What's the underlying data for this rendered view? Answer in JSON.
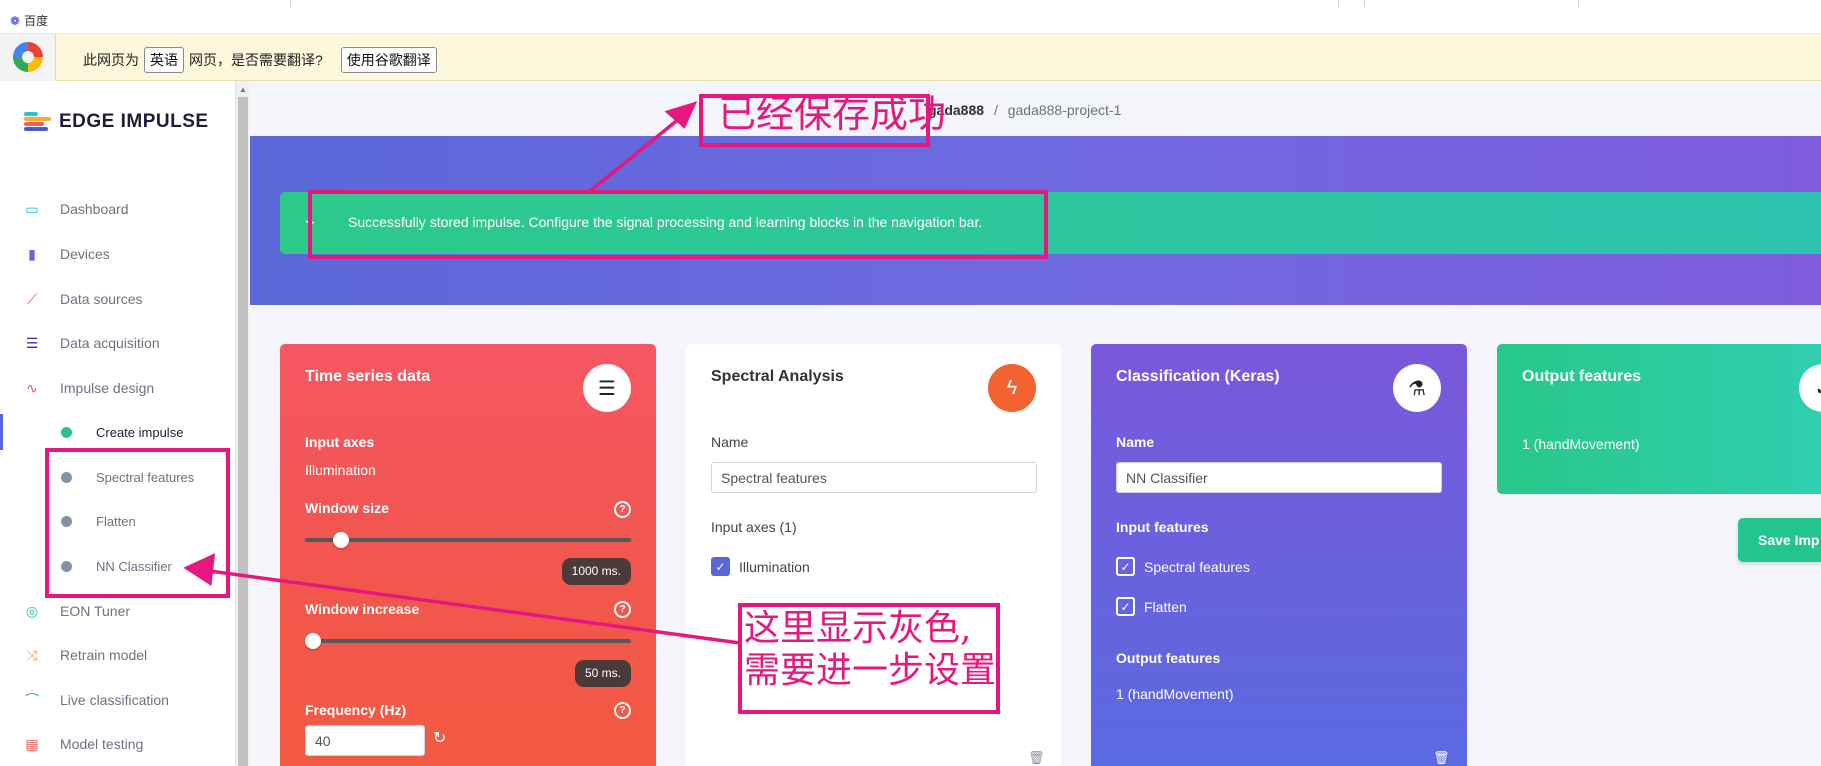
{
  "browser": {
    "tab_title": "百度"
  },
  "translate_bar": {
    "prefix": "此网页为",
    "language": "英语",
    "suffix": "网页，是否需要翻译?",
    "translate_button": "使用谷歌翻译"
  },
  "brand": {
    "name": "EDGE IMPULSE"
  },
  "sidebar": {
    "items": [
      {
        "label": "Dashboard",
        "icon": "monitor-icon"
      },
      {
        "label": "Devices",
        "icon": "chip-icon"
      },
      {
        "label": "Data sources",
        "icon": "wand-icon"
      },
      {
        "label": "Data acquisition",
        "icon": "database-icon"
      },
      {
        "label": "Impulse design",
        "icon": "pulse-icon"
      },
      {
        "label": "Create impulse"
      },
      {
        "label": "Spectral features"
      },
      {
        "label": "Flatten"
      },
      {
        "label": "NN Classifier"
      },
      {
        "label": "EON Tuner",
        "icon": "compass-icon"
      },
      {
        "label": "Retrain model",
        "icon": "shuffle-icon"
      },
      {
        "label": "Live classification",
        "icon": "signal-icon"
      },
      {
        "label": "Model testing",
        "icon": "clipboard-icon"
      }
    ]
  },
  "breadcrumb": {
    "user": "gada888",
    "separator": "/",
    "project": "gada888-project-1"
  },
  "alert": {
    "message": "Successfully stored impulse. Configure the signal processing and learning blocks in the navigation bar."
  },
  "cards": {
    "time_series": {
      "title": "Time series data",
      "input_axes_label": "Input axes",
      "input_axes_value": "Illumination",
      "window_size_label": "Window size",
      "window_size_value": "1000 ms.",
      "window_size_fraction": 0.09,
      "window_increase_label": "Window increase",
      "window_increase_value": "50 ms.",
      "window_increase_fraction": 0.0,
      "frequency_label": "Frequency (Hz)",
      "frequency_value": "40"
    },
    "spectral": {
      "title": "Spectral Analysis",
      "name_label": "Name",
      "name_value": "Spectral features",
      "input_axes_label": "Input axes (1)",
      "axis_option": "Illumination"
    },
    "classification": {
      "title": "Classification (Keras)",
      "name_label": "Name",
      "name_value": "NN Classifier",
      "input_features_label": "Input features",
      "feature_1": "Spectral features",
      "feature_2": "Flatten",
      "output_features_label": "Output features",
      "output_features_value": "1 (handMovement)"
    },
    "output": {
      "title": "Output features",
      "value": "1 (handMovement)"
    }
  },
  "save_button": "Save Imp",
  "annotations": {
    "saved_note": "已经保存成功",
    "gray_note_line1": "这里显示灰色,",
    "gray_note_line2": "需要进一步设置",
    "color": "#e6177f"
  }
}
